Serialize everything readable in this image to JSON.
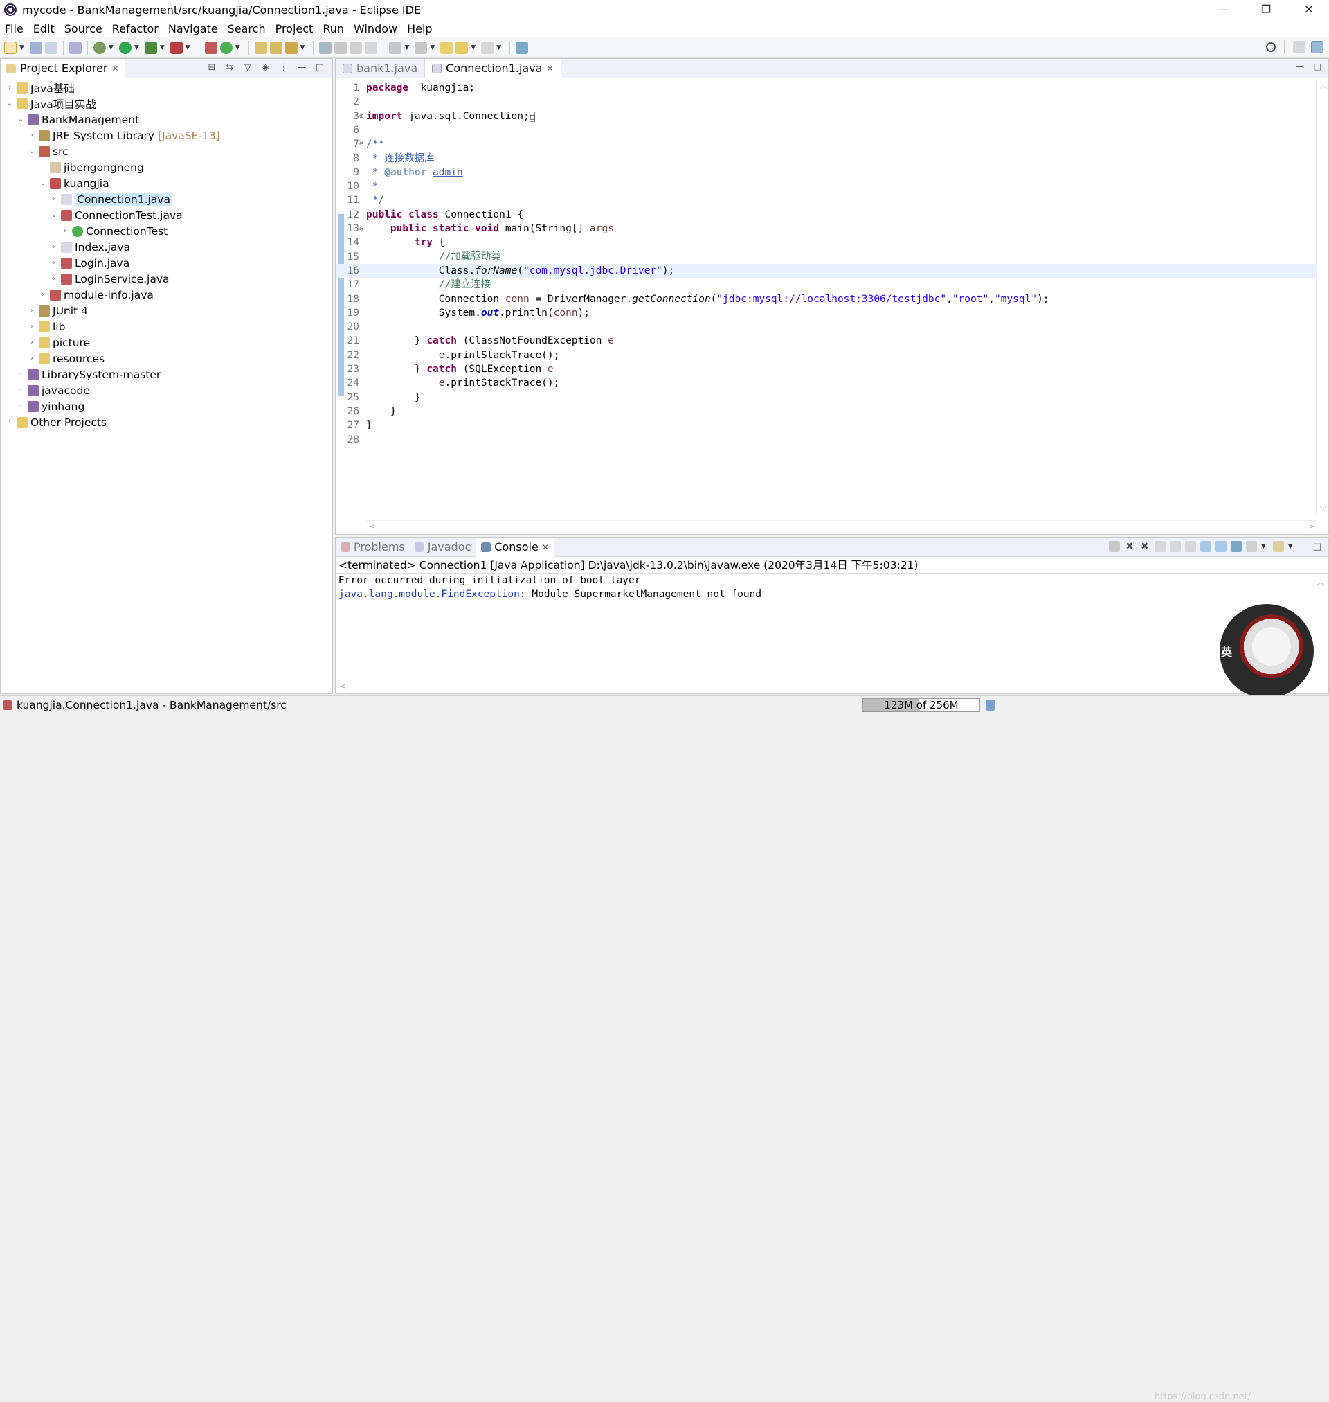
{
  "window": {
    "title": "mycode - BankManagement/src/kuangjia/Connection1.java - Eclipse IDE",
    "controls": {
      "minimize": "—",
      "restore": "❐",
      "close": "✕"
    }
  },
  "menu": [
    "File",
    "Edit",
    "Source",
    "Refactor",
    "Navigate",
    "Search",
    "Project",
    "Run",
    "Window",
    "Help"
  ],
  "project_explorer": {
    "tab_label": "Project Explorer",
    "tab_close": "✕",
    "items": [
      {
        "depth": 0,
        "arrow": "›",
        "icon": "folder-project-icon",
        "label": "Java基础",
        "decor": ""
      },
      {
        "depth": 0,
        "arrow": "⌄",
        "icon": "folder-project-icon",
        "label": "Java项目实战",
        "decor": ""
      },
      {
        "depth": 1,
        "arrow": "⌄",
        "icon": "java-project-icon",
        "label": "BankManagement",
        "decor": ""
      },
      {
        "depth": 2,
        "arrow": "›",
        "icon": "library-icon",
        "label": "JRE System Library",
        "decor": "[JavaSE-13]"
      },
      {
        "depth": 2,
        "arrow": "⌄",
        "icon": "source-folder-icon",
        "label": "src",
        "decor": ""
      },
      {
        "depth": 3,
        "arrow": "",
        "icon": "package-icon",
        "label": "jibengongneng",
        "decor": ""
      },
      {
        "depth": 3,
        "arrow": "⌄",
        "icon": "package-error-icon",
        "label": "kuangjia",
        "decor": ""
      },
      {
        "depth": 4,
        "arrow": "›",
        "icon": "java-file-icon",
        "label": "Connection1.java",
        "decor": "",
        "selected": true
      },
      {
        "depth": 4,
        "arrow": "⌄",
        "icon": "java-file-error-icon",
        "label": "ConnectionTest.java",
        "decor": ""
      },
      {
        "depth": 5,
        "arrow": "›",
        "icon": "class-icon",
        "label": "ConnectionTest",
        "decor": ""
      },
      {
        "depth": 4,
        "arrow": "›",
        "icon": "java-file-icon",
        "label": "Index.java",
        "decor": ""
      },
      {
        "depth": 4,
        "arrow": "›",
        "icon": "java-file-error-icon",
        "label": "Login.java",
        "decor": ""
      },
      {
        "depth": 4,
        "arrow": "›",
        "icon": "java-file-error-icon",
        "label": "LoginService.java",
        "decor": ""
      },
      {
        "depth": 3,
        "arrow": "›",
        "icon": "java-file-error-icon",
        "label": "module-info.java",
        "decor": ""
      },
      {
        "depth": 2,
        "arrow": "›",
        "icon": "library-icon",
        "label": "JUnit 4",
        "decor": ""
      },
      {
        "depth": 2,
        "arrow": "›",
        "icon": "folder-icon",
        "label": "lib",
        "decor": ""
      },
      {
        "depth": 2,
        "arrow": "›",
        "icon": "folder-icon",
        "label": "picture",
        "decor": ""
      },
      {
        "depth": 2,
        "arrow": "›",
        "icon": "folder-icon",
        "label": "resources",
        "decor": ""
      },
      {
        "depth": 1,
        "arrow": "›",
        "icon": "java-project-icon",
        "label": "LibrarySystem-master",
        "decor": ""
      },
      {
        "depth": 1,
        "arrow": "›",
        "icon": "java-project-icon",
        "label": "javacode",
        "decor": ""
      },
      {
        "depth": 1,
        "arrow": "›",
        "icon": "java-project-icon",
        "label": "yinhang",
        "decor": ""
      },
      {
        "depth": 0,
        "arrow": "›",
        "icon": "folder-project-icon",
        "label": "Other Projects",
        "decor": ""
      }
    ]
  },
  "editor": {
    "tabs": [
      {
        "label": "bank1.java",
        "active": false
      },
      {
        "label": "Connection1.java",
        "active": true,
        "close": "✕"
      }
    ],
    "current_line": 16,
    "lines": [
      {
        "n": "1",
        "fold": "",
        "tokens": [
          [
            "kw",
            "package"
          ],
          [
            "",
            "  kuangjia;"
          ]
        ]
      },
      {
        "n": "2",
        "fold": "",
        "tokens": []
      },
      {
        "n": "3",
        "fold": "⊕",
        "tokens": [
          [
            "kw",
            "import"
          ],
          [
            "",
            " java.sql.Connection;"
          ],
          [
            "box",
            "□"
          ]
        ]
      },
      {
        "n": "6",
        "fold": "",
        "tokens": []
      },
      {
        "n": "7",
        "fold": "⊖",
        "tokens": [
          [
            "jd",
            "/**"
          ]
        ]
      },
      {
        "n": "8",
        "fold": "",
        "tokens": [
          [
            "jd",
            " * 连接数据库"
          ]
        ]
      },
      {
        "n": "9",
        "fold": "",
        "tokens": [
          [
            "jd",
            " * "
          ],
          [
            "jdtag",
            "@author"
          ],
          [
            "jd",
            " "
          ],
          [
            "jdlink",
            "admin"
          ]
        ]
      },
      {
        "n": "10",
        "fold": "",
        "tokens": [
          [
            "jd",
            " *"
          ]
        ]
      },
      {
        "n": "11",
        "fold": "",
        "tokens": [
          [
            "jd",
            " */"
          ]
        ]
      },
      {
        "n": "12",
        "fold": "",
        "tokens": [
          [
            "kw",
            "public"
          ],
          [
            "",
            " "
          ],
          [
            "kw",
            "class"
          ],
          [
            "",
            " Connection1 {"
          ]
        ]
      },
      {
        "n": "13",
        "fold": "⊖",
        "tokens": [
          [
            "",
            "    "
          ],
          [
            "kw",
            "public"
          ],
          [
            "",
            " "
          ],
          [
            "kw",
            "static"
          ],
          [
            "",
            " "
          ],
          [
            "kw",
            "void"
          ],
          [
            "",
            " main(String[] "
          ],
          [
            "var",
            "args"
          ],
          [
            ") {"
          ]
        ]
      },
      {
        "n": "14",
        "fold": "",
        "tokens": [
          [
            "",
            "        "
          ],
          [
            "kw",
            "try"
          ],
          [
            "",
            " {"
          ]
        ]
      },
      {
        "n": "15",
        "fold": "",
        "tokens": [
          [
            "",
            "            "
          ],
          [
            "cm",
            "//加载驱动类"
          ]
        ]
      },
      {
        "n": "16",
        "fold": "",
        "tokens": [
          [
            "",
            "            Class."
          ],
          [
            "ital",
            "forName"
          ],
          [
            "",
            "("
          ],
          [
            "str",
            "\"com.mysql.jdbc.Driver\""
          ],
          [
            "",
            ");"
          ]
        ]
      },
      {
        "n": "17",
        "fold": "",
        "tokens": [
          [
            "",
            "            "
          ],
          [
            "cm",
            "//建立连接"
          ]
        ]
      },
      {
        "n": "18",
        "fold": "",
        "tokens": [
          [
            "",
            "            Connection "
          ],
          [
            "var",
            "conn"
          ],
          [
            "",
            " = DriverManager."
          ],
          [
            "ital",
            "getConnection"
          ],
          [
            "",
            "("
          ],
          [
            "str",
            "\"jdbc:mysql://localhost:3306/testjdbc\""
          ],
          [
            "",
            ","
          ],
          [
            "str",
            "\"root\""
          ],
          [
            "",
            ","
          ],
          [
            "str",
            "\"mysql\""
          ],
          [
            "",
            ");"
          ]
        ]
      },
      {
        "n": "19",
        "fold": "",
        "tokens": [
          [
            "",
            "            System."
          ],
          [
            "stat",
            "out"
          ],
          [
            "",
            ".println("
          ],
          [
            "var",
            "conn"
          ],
          [
            "",
            ");"
          ]
        ]
      },
      {
        "n": "20",
        "fold": "",
        "tokens": []
      },
      {
        "n": "21",
        "fold": "",
        "tokens": [
          [
            "",
            "        } "
          ],
          [
            "kw",
            "catch"
          ],
          [
            "",
            " (ClassNotFoundException "
          ],
          [
            "var",
            "e"
          ],
          [
            ") {"
          ]
        ]
      },
      {
        "n": "22",
        "fold": "",
        "tokens": [
          [
            "",
            "            "
          ],
          [
            "var",
            "e"
          ],
          [
            "",
            ".printStackTrace();"
          ]
        ]
      },
      {
        "n": "23",
        "fold": "",
        "tokens": [
          [
            "",
            "        } "
          ],
          [
            "kw",
            "catch"
          ],
          [
            "",
            " (SQLException "
          ],
          [
            "var",
            "e"
          ],
          [
            ") {"
          ]
        ]
      },
      {
        "n": "24",
        "fold": "",
        "tokens": [
          [
            "",
            "            "
          ],
          [
            "var",
            "e"
          ],
          [
            "",
            ".printStackTrace();"
          ]
        ]
      },
      {
        "n": "25",
        "fold": "",
        "tokens": [
          [
            "",
            "        }"
          ]
        ]
      },
      {
        "n": "26",
        "fold": "",
        "tokens": [
          [
            "",
            "    }"
          ]
        ]
      },
      {
        "n": "27",
        "fold": "",
        "tokens": [
          [
            "",
            "}"
          ]
        ]
      },
      {
        "n": "28",
        "fold": "",
        "tokens": []
      }
    ]
  },
  "console": {
    "tabs": [
      {
        "label": "Problems",
        "active": false,
        "icon": "problems-icon"
      },
      {
        "label": "Javadoc",
        "active": false,
        "icon": "javadoc-icon"
      },
      {
        "label": "Console",
        "active": true,
        "icon": "console-icon",
        "close": "✕"
      }
    ],
    "status": "<terminated> Connection1 [Java Application] D:\\java\\jdk-13.0.2\\bin\\javaw.exe (2020年3月14日 下午5:03:21)",
    "output_line1": "Error occurred during initialization of boot layer",
    "output_line2_link": "java.lang.module.FindException",
    "output_line2_rest": ": Module SupermarketManagement not found"
  },
  "statusbar": {
    "selection": "kuangjia.Connection1.java - BankManagement/src",
    "heap_used_label": "123M",
    "heap_sep": " of ",
    "heap_total_label": "256M",
    "heap_used_mb": 123,
    "heap_total_mb": 256
  },
  "watermark": "https://blog.csdn.net/",
  "avatar_char": "英"
}
